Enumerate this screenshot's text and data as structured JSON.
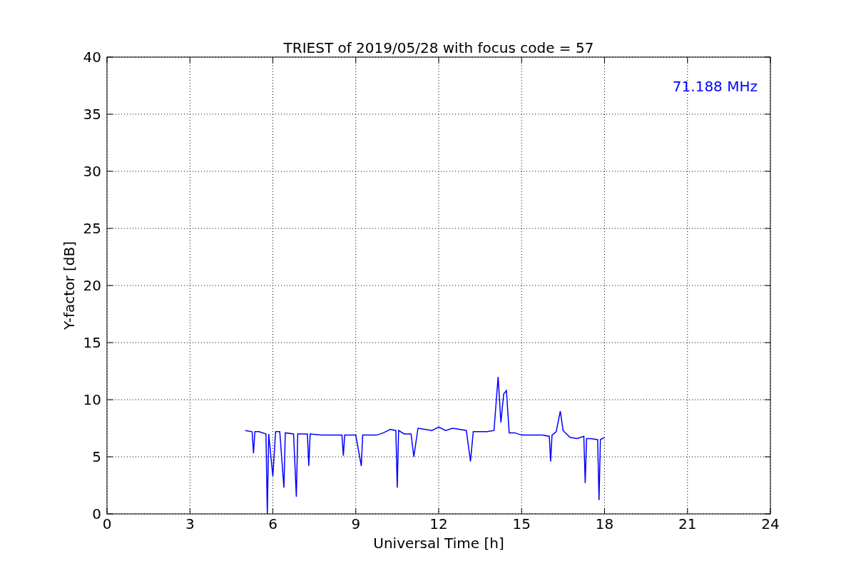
{
  "figure": {
    "chart_data": {
      "type": "line",
      "title": "TRIEST of 2019/05/28 with focus code = 57",
      "xlabel": "Universal Time [h]",
      "ylabel": "Y-factor [dB]",
      "x": [
        5.0,
        5.25,
        5.3,
        5.35,
        5.5,
        5.75,
        5.8,
        5.85,
        6.0,
        6.1,
        6.25,
        6.4,
        6.45,
        6.75,
        6.85,
        6.9,
        7.25,
        7.3,
        7.35,
        7.75,
        8.25,
        8.5,
        8.55,
        8.6,
        9.0,
        9.2,
        9.25,
        9.75,
        10.0,
        10.25,
        10.45,
        10.5,
        10.55,
        10.75,
        11.0,
        11.1,
        11.25,
        11.5,
        11.75,
        12.0,
        12.25,
        12.5,
        12.75,
        13.0,
        13.15,
        13.25,
        13.5,
        13.75,
        14.0,
        14.15,
        14.25,
        14.35,
        14.45,
        14.55,
        14.75,
        15.0,
        15.5,
        15.75,
        16.0,
        16.05,
        16.1,
        16.25,
        16.4,
        16.5,
        16.75,
        17.0,
        17.25,
        17.3,
        17.35,
        17.5,
        17.75,
        17.8,
        17.85,
        18.0
      ],
      "series": [
        {
          "color": "#0000ff",
          "values": [
            7.3,
            7.2,
            5.3,
            7.2,
            7.2,
            7.0,
            0.0,
            7.0,
            3.3,
            7.2,
            7.2,
            2.3,
            7.1,
            7.0,
            1.5,
            7.0,
            7.0,
            4.2,
            7.0,
            6.9,
            6.9,
            6.9,
            5.1,
            6.9,
            6.9,
            4.2,
            6.9,
            6.9,
            7.1,
            7.4,
            7.3,
            2.3,
            7.3,
            7.0,
            7.0,
            5.0,
            7.5,
            7.4,
            7.3,
            7.6,
            7.3,
            7.5,
            7.4,
            7.3,
            4.6,
            7.2,
            7.2,
            7.2,
            7.3,
            12.0,
            8.0,
            10.5,
            10.8,
            7.1,
            7.1,
            6.9,
            6.9,
            6.9,
            6.8,
            4.6,
            6.9,
            7.2,
            9.0,
            7.3,
            6.7,
            6.6,
            6.8,
            2.7,
            6.6,
            6.6,
            6.5,
            1.2,
            6.5,
            6.7
          ]
        }
      ],
      "xlim": [
        0,
        24
      ],
      "ylim": [
        0,
        40
      ],
      "xticks": [
        0,
        3,
        6,
        9,
        12,
        15,
        18,
        21,
        24
      ],
      "yticks": [
        0,
        5,
        10,
        15,
        20,
        25,
        30,
        35,
        40
      ],
      "grid": true,
      "annotations": [
        {
          "text": "71.188 MHz"
        }
      ]
    }
  }
}
